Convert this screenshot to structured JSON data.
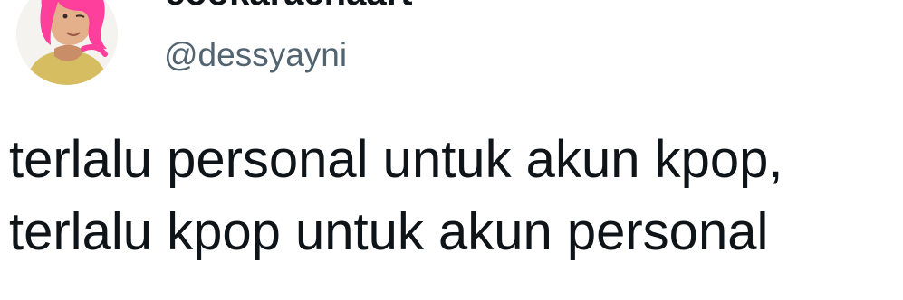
{
  "author": {
    "display_name": "cookaracnaart",
    "handle": "@dessyayni",
    "avatar_icon": "user-avatar-photo"
  },
  "tweet": {
    "text": "terlalu personal untuk akun kpop,\nterlalu kpop untuk akun personal"
  },
  "colors": {
    "text": "#0f1419",
    "handle": "#536471",
    "hair": "#ff3f9b",
    "skin": "#d8a27a",
    "shirt": "#e4c95d"
  }
}
